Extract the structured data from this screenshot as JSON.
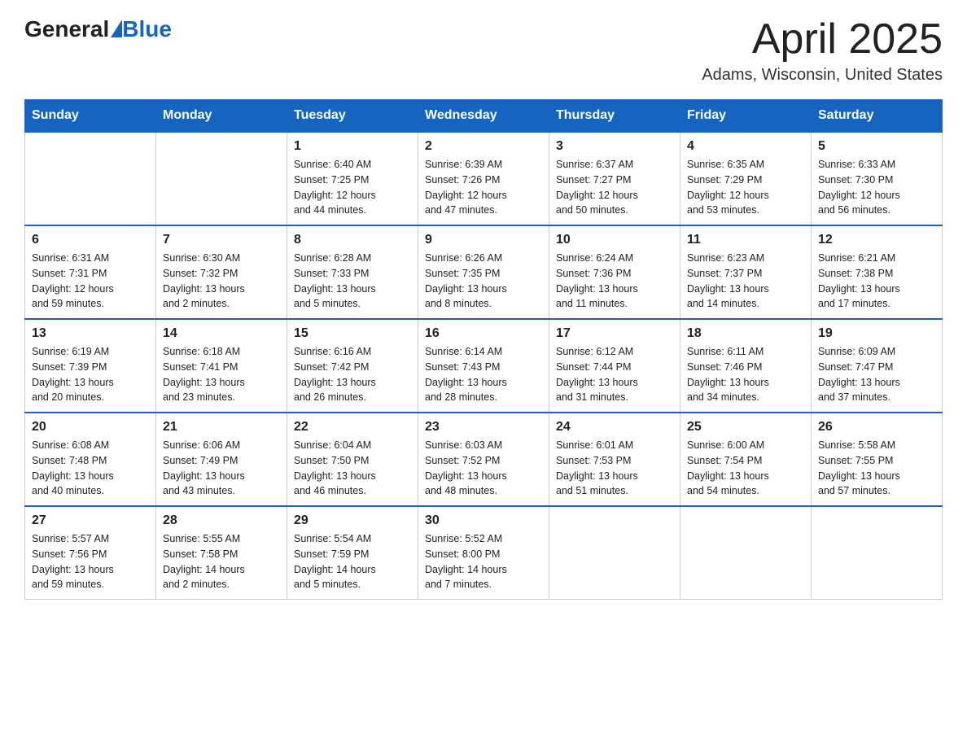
{
  "header": {
    "logo_general": "General",
    "logo_blue": "Blue",
    "title": "April 2025",
    "subtitle": "Adams, Wisconsin, United States"
  },
  "days_of_week": [
    "Sunday",
    "Monday",
    "Tuesday",
    "Wednesday",
    "Thursday",
    "Friday",
    "Saturday"
  ],
  "weeks": [
    [
      {
        "day": "",
        "info": ""
      },
      {
        "day": "",
        "info": ""
      },
      {
        "day": "1",
        "info": "Sunrise: 6:40 AM\nSunset: 7:25 PM\nDaylight: 12 hours\nand 44 minutes."
      },
      {
        "day": "2",
        "info": "Sunrise: 6:39 AM\nSunset: 7:26 PM\nDaylight: 12 hours\nand 47 minutes."
      },
      {
        "day": "3",
        "info": "Sunrise: 6:37 AM\nSunset: 7:27 PM\nDaylight: 12 hours\nand 50 minutes."
      },
      {
        "day": "4",
        "info": "Sunrise: 6:35 AM\nSunset: 7:29 PM\nDaylight: 12 hours\nand 53 minutes."
      },
      {
        "day": "5",
        "info": "Sunrise: 6:33 AM\nSunset: 7:30 PM\nDaylight: 12 hours\nand 56 minutes."
      }
    ],
    [
      {
        "day": "6",
        "info": "Sunrise: 6:31 AM\nSunset: 7:31 PM\nDaylight: 12 hours\nand 59 minutes."
      },
      {
        "day": "7",
        "info": "Sunrise: 6:30 AM\nSunset: 7:32 PM\nDaylight: 13 hours\nand 2 minutes."
      },
      {
        "day": "8",
        "info": "Sunrise: 6:28 AM\nSunset: 7:33 PM\nDaylight: 13 hours\nand 5 minutes."
      },
      {
        "day": "9",
        "info": "Sunrise: 6:26 AM\nSunset: 7:35 PM\nDaylight: 13 hours\nand 8 minutes."
      },
      {
        "day": "10",
        "info": "Sunrise: 6:24 AM\nSunset: 7:36 PM\nDaylight: 13 hours\nand 11 minutes."
      },
      {
        "day": "11",
        "info": "Sunrise: 6:23 AM\nSunset: 7:37 PM\nDaylight: 13 hours\nand 14 minutes."
      },
      {
        "day": "12",
        "info": "Sunrise: 6:21 AM\nSunset: 7:38 PM\nDaylight: 13 hours\nand 17 minutes."
      }
    ],
    [
      {
        "day": "13",
        "info": "Sunrise: 6:19 AM\nSunset: 7:39 PM\nDaylight: 13 hours\nand 20 minutes."
      },
      {
        "day": "14",
        "info": "Sunrise: 6:18 AM\nSunset: 7:41 PM\nDaylight: 13 hours\nand 23 minutes."
      },
      {
        "day": "15",
        "info": "Sunrise: 6:16 AM\nSunset: 7:42 PM\nDaylight: 13 hours\nand 26 minutes."
      },
      {
        "day": "16",
        "info": "Sunrise: 6:14 AM\nSunset: 7:43 PM\nDaylight: 13 hours\nand 28 minutes."
      },
      {
        "day": "17",
        "info": "Sunrise: 6:12 AM\nSunset: 7:44 PM\nDaylight: 13 hours\nand 31 minutes."
      },
      {
        "day": "18",
        "info": "Sunrise: 6:11 AM\nSunset: 7:46 PM\nDaylight: 13 hours\nand 34 minutes."
      },
      {
        "day": "19",
        "info": "Sunrise: 6:09 AM\nSunset: 7:47 PM\nDaylight: 13 hours\nand 37 minutes."
      }
    ],
    [
      {
        "day": "20",
        "info": "Sunrise: 6:08 AM\nSunset: 7:48 PM\nDaylight: 13 hours\nand 40 minutes."
      },
      {
        "day": "21",
        "info": "Sunrise: 6:06 AM\nSunset: 7:49 PM\nDaylight: 13 hours\nand 43 minutes."
      },
      {
        "day": "22",
        "info": "Sunrise: 6:04 AM\nSunset: 7:50 PM\nDaylight: 13 hours\nand 46 minutes."
      },
      {
        "day": "23",
        "info": "Sunrise: 6:03 AM\nSunset: 7:52 PM\nDaylight: 13 hours\nand 48 minutes."
      },
      {
        "day": "24",
        "info": "Sunrise: 6:01 AM\nSunset: 7:53 PM\nDaylight: 13 hours\nand 51 minutes."
      },
      {
        "day": "25",
        "info": "Sunrise: 6:00 AM\nSunset: 7:54 PM\nDaylight: 13 hours\nand 54 minutes."
      },
      {
        "day": "26",
        "info": "Sunrise: 5:58 AM\nSunset: 7:55 PM\nDaylight: 13 hours\nand 57 minutes."
      }
    ],
    [
      {
        "day": "27",
        "info": "Sunrise: 5:57 AM\nSunset: 7:56 PM\nDaylight: 13 hours\nand 59 minutes."
      },
      {
        "day": "28",
        "info": "Sunrise: 5:55 AM\nSunset: 7:58 PM\nDaylight: 14 hours\nand 2 minutes."
      },
      {
        "day": "29",
        "info": "Sunrise: 5:54 AM\nSunset: 7:59 PM\nDaylight: 14 hours\nand 5 minutes."
      },
      {
        "day": "30",
        "info": "Sunrise: 5:52 AM\nSunset: 8:00 PM\nDaylight: 14 hours\nand 7 minutes."
      },
      {
        "day": "",
        "info": ""
      },
      {
        "day": "",
        "info": ""
      },
      {
        "day": "",
        "info": ""
      }
    ]
  ]
}
